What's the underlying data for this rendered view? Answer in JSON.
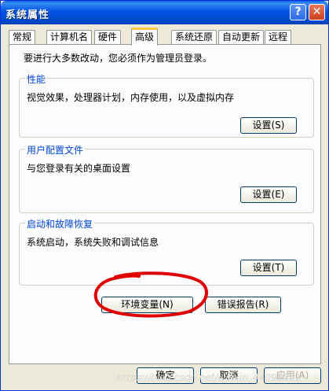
{
  "window": {
    "title": "系统属性",
    "help_glyph": "?",
    "close_glyph": "✕"
  },
  "tabs": [
    "常规",
    "计算机名",
    "硬件",
    "高级",
    "系统还原",
    "自动更新",
    "远程"
  ],
  "intro": "要进行大多数改动，您必须作为管理员登录。",
  "groups": {
    "performance": {
      "title": "性能",
      "desc": "视觉效果，处理器计划，内存使用，以及虚拟内存",
      "button": "设置(S)"
    },
    "profiles": {
      "title": "用户配置文件",
      "desc": "与您登录有关的桌面设置",
      "button": "设置(E)"
    },
    "startup": {
      "title": "启动和故障恢复",
      "desc": "系统启动，系统失败和调试信息",
      "button": "设置(T)"
    }
  },
  "buttons": {
    "env_vars": "环境变量(N)",
    "error_report": "错误报告(R)",
    "ok": "确定",
    "cancel": "取消",
    "apply": "应用(A)"
  },
  "watermark": "https://blog.csdn.net/weixin_44098851",
  "colors": {
    "titlebar": "#0054e3",
    "group_title": "#0046d5",
    "annotation": "#e00000",
    "active_tab_accent": "#ffc83c"
  }
}
